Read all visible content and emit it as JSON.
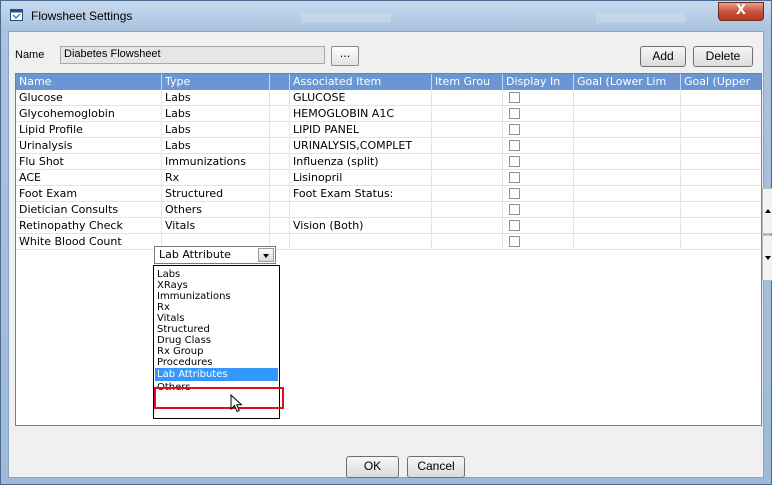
{
  "window": {
    "title": "Flowsheet Settings",
    "close_glyph": "X"
  },
  "form": {
    "name_label": "Name",
    "name_value": "Diabetes Flowsheet",
    "browse_label": "...",
    "add_label": "Add",
    "delete_label": "Delete",
    "ok_label": "OK",
    "cancel_label": "Cancel"
  },
  "grid": {
    "columns": [
      "Name",
      "Type",
      "",
      "Associated Item",
      "Item Grou",
      "Display In",
      "Goal (Lower Lim",
      "Goal (Upper"
    ],
    "rows": [
      {
        "name": "Glucose",
        "type": "Labs",
        "item": "GLUCOSE"
      },
      {
        "name": "Glycohemoglobin",
        "type": "Labs",
        "item": "HEMOGLOBIN A1C"
      },
      {
        "name": "Lipid Profile",
        "type": "Labs",
        "item": "LIPID PANEL"
      },
      {
        "name": "Urinalysis",
        "type": "Labs",
        "item": "URINALYSIS,COMPLET"
      },
      {
        "name": "Flu Shot",
        "type": "Immunizations",
        "item": "Influenza (split)"
      },
      {
        "name": "ACE",
        "type": "Rx",
        "item": "Lisinopril"
      },
      {
        "name": "Foot Exam",
        "type": "Structured",
        "item": "Foot Exam Status:"
      },
      {
        "name": "Dietician Consults",
        "type": "Others",
        "item": ""
      },
      {
        "name": "Retinopathy Check",
        "type": "Vitals",
        "item": "Vision (Both)"
      },
      {
        "name": "White Blood Count",
        "type": "Lab Attribute",
        "item": ""
      }
    ]
  },
  "dropdown": {
    "options": [
      "Labs",
      "XRays",
      "Immunizations",
      "Rx",
      "Vitals",
      "Structured",
      "Drug Class",
      "Rx Group",
      "Procedures",
      "Lab Attributes",
      "Others"
    ],
    "selected": "Lab Attributes"
  },
  "colors": {
    "header_bg": "#6a96d4",
    "selection": "#3399ff",
    "highlight_box": "#e0101a"
  }
}
